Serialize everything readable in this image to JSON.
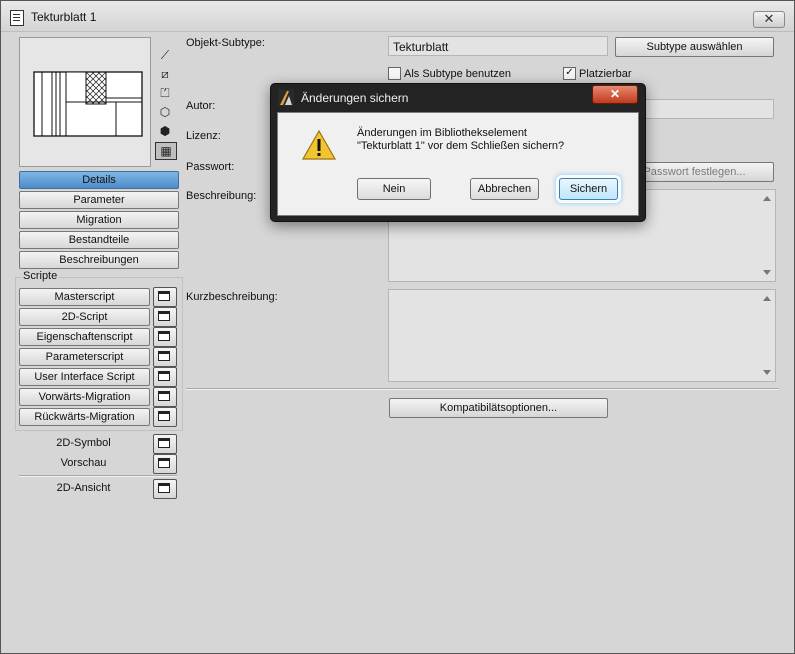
{
  "window": {
    "title": "Tekturblatt 1",
    "close_glyph": "✕"
  },
  "view_icons": [
    {
      "name": "axonometric-icon",
      "glyph": "⟋"
    },
    {
      "name": "plan-icon",
      "glyph": "⧄"
    },
    {
      "name": "elevation-icon",
      "glyph": "⏍"
    },
    {
      "name": "3d-wire-icon",
      "glyph": "⬡"
    },
    {
      "name": "3d-solid-icon",
      "glyph": "⬢"
    },
    {
      "name": "texture-icon",
      "glyph": "▦"
    }
  ],
  "nav": {
    "details": "Details",
    "parameter": "Parameter",
    "migration": "Migration",
    "bestandteile": "Bestandteile",
    "beschreibungen": "Beschreibungen"
  },
  "scripts": {
    "group_label": "Scripte",
    "items": [
      "Masterscript",
      "2D-Script",
      "Eigenschaftenscript",
      "Parameterscript",
      "User Interface Script",
      "Vorwärts-Migration",
      "Rückwärts-Migration"
    ]
  },
  "extras": {
    "symbol_2d": "2D-Symbol",
    "vorschau": "Vorschau",
    "ansicht_2d": "2D-Ansicht"
  },
  "details": {
    "subtype_label": "Objekt-Subtype:",
    "subtype_value": "Tekturblatt",
    "subtype_button": "Subtype auswählen",
    "als_subtype_label": "Als Subtype benutzen",
    "als_subtype_checked": false,
    "platzierbar_label": "Platzierbar",
    "platzierbar_checked": true,
    "autor_label": "Autor:",
    "lizenz_label": "Lizenz:",
    "passwort_label": "Passwort:",
    "passwort_button": "Passwort festlegen...",
    "beschreibung_label": "Beschreibung:",
    "kurzbeschreibung_label": "Kurzbeschreibung:",
    "kompat_button": "Kompatibilätsoptionen..."
  },
  "dialog": {
    "title": "Änderungen sichern",
    "close_glyph": "✕",
    "message_line1": "Änderungen im Bibliothekselement",
    "message_line2": "\"Tekturblatt 1\" vor dem Schließen sichern?",
    "nein": "Nein",
    "abbrechen": "Abbrechen",
    "sichern": "Sichern"
  },
  "colors": {
    "active_nav": "#5b9ad5",
    "dialog_frame": "#232323",
    "close_red": "#c23a1c",
    "warning_yellow": "#f2c430"
  }
}
